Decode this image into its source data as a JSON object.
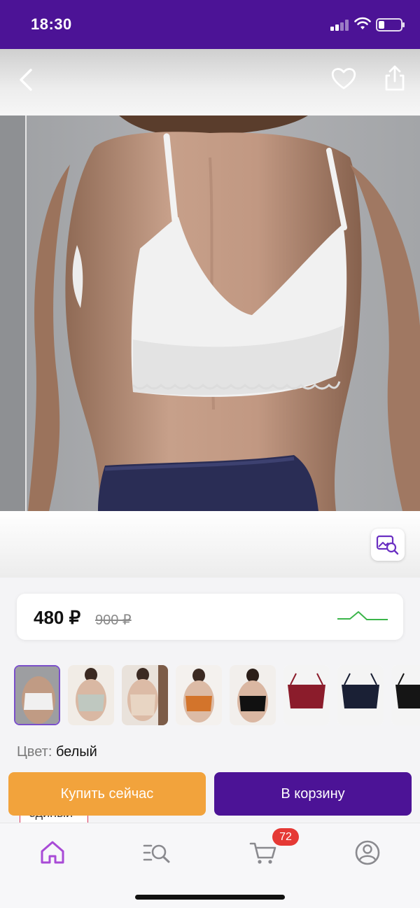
{
  "status_bar": {
    "time": "18:30"
  },
  "header": {
    "back_icon": "chevron-left-icon",
    "favorite_icon": "heart-outline-icon",
    "share_icon": "share-icon"
  },
  "product": {
    "image_alt": "product-photo",
    "image_search_icon": "image-search-icon"
  },
  "price": {
    "current": "480 ₽",
    "old": "900 ₽",
    "trend_color": "#3bb54a"
  },
  "thumbnails": [
    {
      "name": "white",
      "color": "#ececec"
    },
    {
      "name": "light-green",
      "color": "#bfc8c0"
    },
    {
      "name": "beige",
      "color": "#e8d5c3"
    },
    {
      "name": "orange",
      "color": "#d3742b"
    },
    {
      "name": "black",
      "color": "#111111"
    },
    {
      "name": "burgundy",
      "color": "#8b1c2b"
    },
    {
      "name": "navy",
      "color": "#1a2035"
    },
    {
      "name": "black-2",
      "color": "#151515"
    }
  ],
  "variant": {
    "color_label": "Цвет:",
    "color_value": "белый",
    "size_value": "единый"
  },
  "actions": {
    "buy_now": "Купить сейчас",
    "add_to_cart": "В корзину"
  },
  "bottom_nav": {
    "items": [
      {
        "icon": "home-icon",
        "active": true
      },
      {
        "icon": "catalog-search-icon",
        "active": false
      },
      {
        "icon": "cart-icon",
        "active": false
      },
      {
        "icon": "profile-icon",
        "active": false
      }
    ],
    "cart_badge": "72"
  },
  "colors": {
    "brand": "#4c1396",
    "accent": "#f2a33c",
    "badge": "#e53935"
  }
}
